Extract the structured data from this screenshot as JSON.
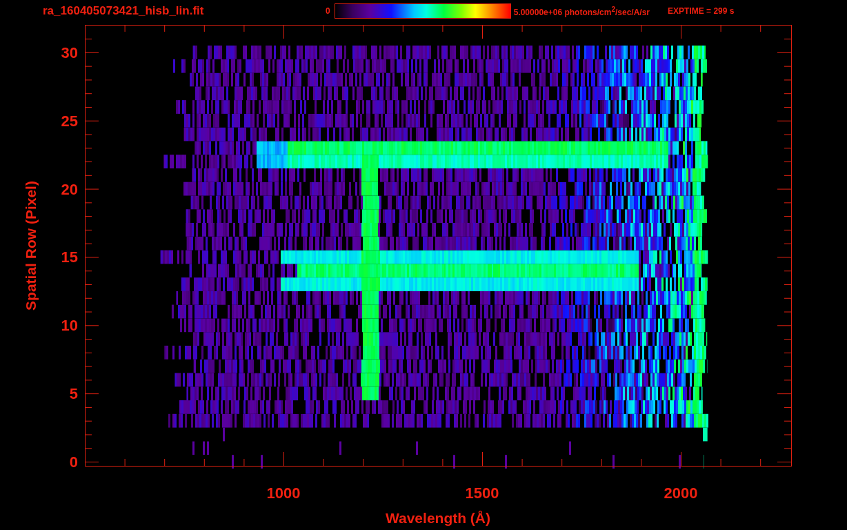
{
  "title": "ra_160405073421_hisb_lin.fit",
  "colorbar": {
    "min_label": "0",
    "max_label": "5.00000e+06 photons/cm$^{2}$/sec/A/sr"
  },
  "exposure": "EXPTIME = 299 s",
  "plot": {
    "xlabel": "Wavelength (Å)",
    "ylabel": "Spatial Row (Pixel)",
    "xticks": [
      "1000",
      "1500",
      "2000"
    ],
    "yticks": [
      "30",
      "25",
      "20",
      "15",
      "10",
      "5",
      "0"
    ]
  }
}
